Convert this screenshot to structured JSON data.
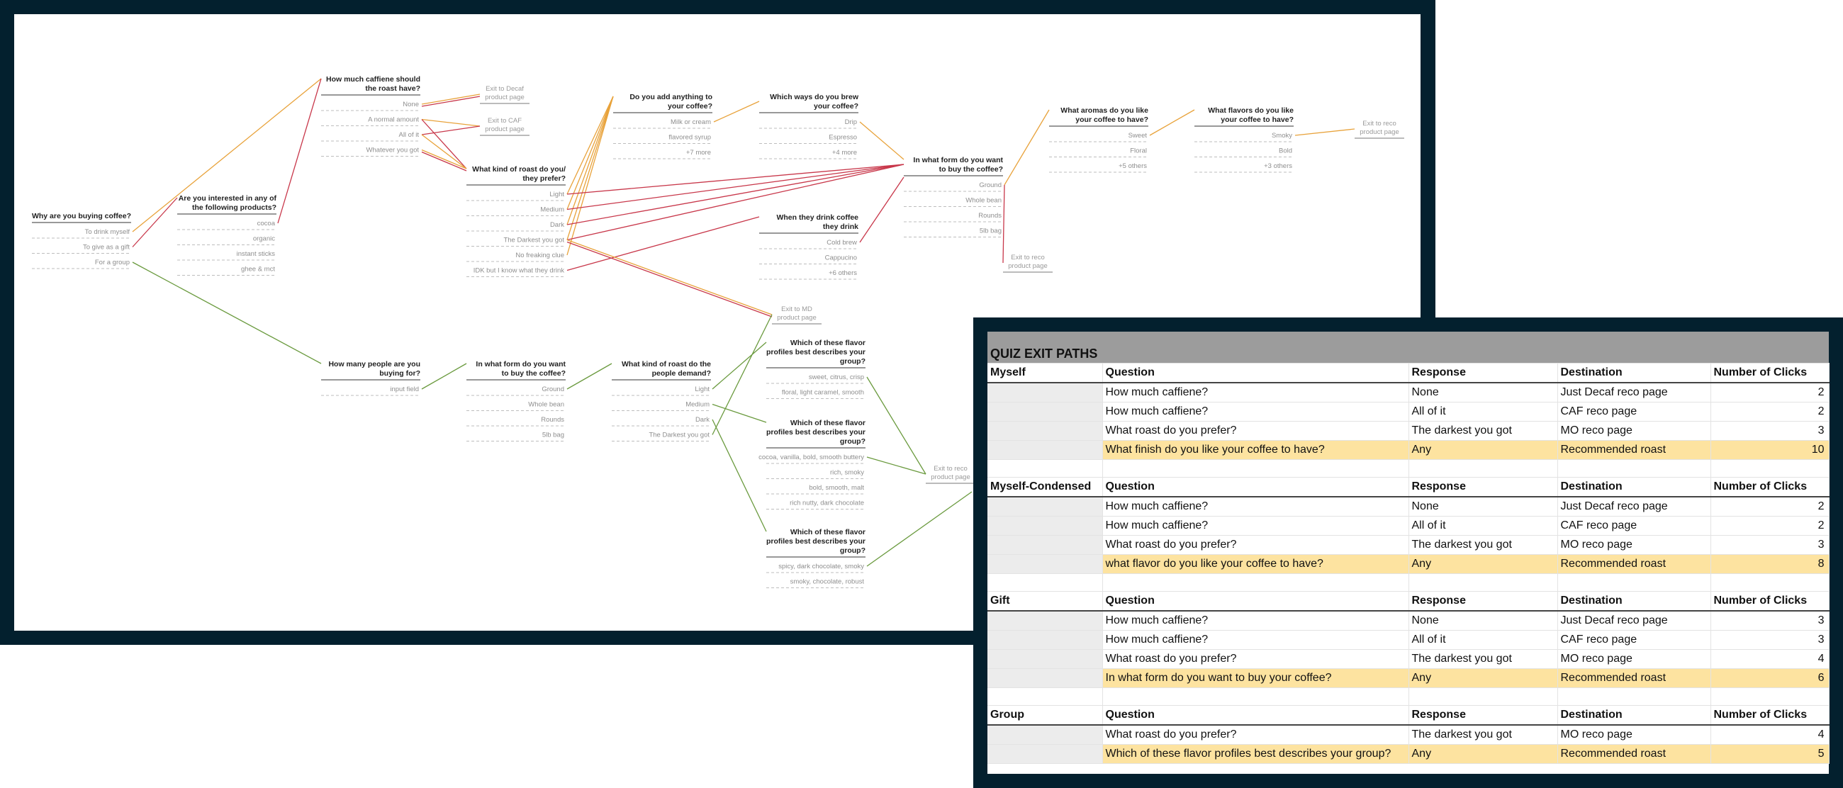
{
  "colors": {
    "orange": "#e8a23a",
    "red": "#c8374a",
    "green": "#6a9a3e",
    "frame": "#03202e"
  },
  "diagram": {
    "nodes": [
      {
        "id": "why",
        "question": "Why are you buying coffee?",
        "options": [
          "To drink myself",
          "To give as a gift",
          "For a group"
        ]
      },
      {
        "id": "interest",
        "question": "Are you interested in any of the following products?",
        "options": [
          "cocoa",
          "organic",
          "instant sticks",
          "ghee & mct"
        ]
      },
      {
        "id": "caffeine",
        "question": "How much caffiene should the roast have?",
        "options": [
          "None",
          "A normal amount",
          "All of it",
          "Whatever you got"
        ]
      },
      {
        "id": "roast",
        "question": "What kind of roast do you they prefer?",
        "options": [
          "Light",
          "Medium",
          "Dark",
          "The Darkest you got",
          "No freaking clue",
          "IDK but I know what they drink"
        ]
      },
      {
        "id": "add",
        "question": "Do you add anything to your coffee?",
        "options": [
          "Milk or cream",
          "flavored syrup",
          "+7 more"
        ]
      },
      {
        "id": "brew",
        "question": "Which ways do you brew your coffee?",
        "options": [
          "Drip",
          "Espresso",
          "+4 more"
        ]
      },
      {
        "id": "drinkwhen",
        "question": "When they drink coffee they drink",
        "options": [
          "Cold brew",
          "Cappucino",
          "+6 others"
        ]
      },
      {
        "id": "form",
        "question": "In what form do you want to buy the coffee?",
        "options": [
          "Ground",
          "Whole bean",
          "Rounds",
          "5lb bag"
        ]
      },
      {
        "id": "aromas",
        "question": "What aromas do you like your coffee to have?",
        "options": [
          "Sweet",
          "Floral",
          "+5 others"
        ]
      },
      {
        "id": "flavors",
        "question": "What flavors do you like your coffee to have?",
        "options": [
          "Smoky",
          "Bold",
          "+3 others"
        ]
      },
      {
        "id": "people",
        "question": "How many people are you buying for?",
        "options": [
          "input field"
        ]
      },
      {
        "id": "gform",
        "question": "In what form do you want to buy the coffee?",
        "options": [
          "Ground",
          "Whole bean",
          "Rounds",
          "5lb bag"
        ]
      },
      {
        "id": "groast",
        "question": "What kind of roast do the people demand?",
        "options": [
          "Light",
          "Medium",
          "Dark",
          "The Darkest you got"
        ]
      },
      {
        "id": "prof1",
        "question": "Which of these flavor profiles best describes your group?",
        "options": [
          "sweet, citrus, crisp",
          "floral, light caramel, smooth"
        ]
      },
      {
        "id": "prof2",
        "question": "Which of these flavor profiles best describes your group?",
        "options": [
          "cocoa, vanilla, bold, smooth buttery",
          "rich, smoky",
          "bold, smooth, malt",
          "rich nutty, dark chocolate"
        ]
      },
      {
        "id": "prof3",
        "question": "Which of these flavor profiles best describes your group?",
        "options": [
          "spicy, dark chocolate, smoky",
          "smoky, chocolate, robust"
        ]
      }
    ],
    "exits": [
      {
        "id": "decaf",
        "label": "Exit to Decaf product page"
      },
      {
        "id": "caf",
        "label": "Exit to CAF product page"
      },
      {
        "id": "md",
        "label": "Exit to MD product page"
      },
      {
        "id": "reco1",
        "label": "Exit to reco product page"
      },
      {
        "id": "reco2",
        "label": "Exit to reco product page"
      },
      {
        "id": "reco3",
        "label": "Exit to reco product page"
      }
    ]
  },
  "table": {
    "title": "QUIZ EXIT PATHS",
    "columns": [
      "Question",
      "Response",
      "Destination",
      "Number of Clicks"
    ],
    "groups": [
      {
        "name": "Myself",
        "rows": [
          {
            "question": "How much caffiene?",
            "response": "None",
            "destination": "Just Decaf reco page",
            "clicks": 2,
            "highlight": false
          },
          {
            "question": "How much caffiene?",
            "response": "All of it",
            "destination": "CAF reco page",
            "clicks": 2,
            "highlight": false
          },
          {
            "question": "What roast do you prefer?",
            "response": "The darkest you got",
            "destination": "MO reco page",
            "clicks": 3,
            "highlight": false
          },
          {
            "question": "What finish do you like your coffee to have?",
            "response": "Any",
            "destination": "Recommended roast",
            "clicks": 10,
            "highlight": true
          }
        ]
      },
      {
        "name": "Myself-Condensed",
        "rows": [
          {
            "question": "How much caffiene?",
            "response": "None",
            "destination": "Just Decaf reco page",
            "clicks": 2,
            "highlight": false
          },
          {
            "question": "How much caffiene?",
            "response": "All of it",
            "destination": "CAF reco page",
            "clicks": 2,
            "highlight": false
          },
          {
            "question": "What roast do you prefer?",
            "response": "The darkest you got",
            "destination": "MO reco page",
            "clicks": 3,
            "highlight": false
          },
          {
            "question": "what flavor do you like your coffee to have?",
            "response": "Any",
            "destination": "Recommended roast",
            "clicks": 8,
            "highlight": true
          }
        ]
      },
      {
        "name": "Gift",
        "rows": [
          {
            "question": "How much caffiene?",
            "response": "None",
            "destination": "Just Decaf reco page",
            "clicks": 3,
            "highlight": false
          },
          {
            "question": "How much caffiene?",
            "response": "All of it",
            "destination": "CAF reco page",
            "clicks": 3,
            "highlight": false
          },
          {
            "question": "What roast do you prefer?",
            "response": "The darkest you got",
            "destination": "MO reco page",
            "clicks": 4,
            "highlight": false
          },
          {
            "question": "In what form do you want to buy your coffee?",
            "response": "Any",
            "destination": "Recommended roast",
            "clicks": 6,
            "highlight": true
          }
        ]
      },
      {
        "name": "Group",
        "rows": [
          {
            "question": "What roast do you prefer?",
            "response": "The darkest you got",
            "destination": "MO reco page",
            "clicks": 4,
            "highlight": false
          },
          {
            "question": "Which of these flavor profiles best describes your group?",
            "response": "Any",
            "destination": "Recommended roast",
            "clicks": 5,
            "highlight": true
          }
        ]
      }
    ]
  }
}
